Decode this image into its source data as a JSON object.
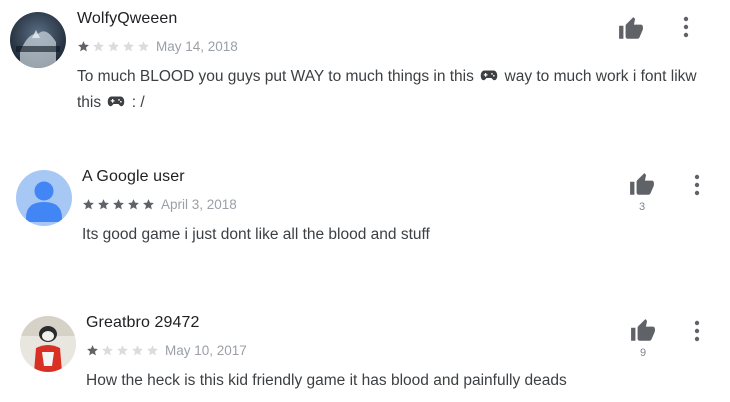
{
  "colors": {
    "star_filled": "#5f6368",
    "star_empty": "#dadce0",
    "icon": "#5f6368"
  },
  "reviews": [
    {
      "author": "WolfyQweeen",
      "rating": 1,
      "date": "May 14, 2018",
      "text_line1": "To much BLOOD you guys put WAY to much things in this",
      "text_line1b": "way to much work i font likw",
      "text_line2": "this",
      "text_line2b": ": /",
      "emoji_icon": "gamepad-icon",
      "helpful_count": ""
    },
    {
      "author": "A Google user",
      "rating": 5,
      "date": "April 3, 2018",
      "text": "Its good game i just dont like all the blood and stuff",
      "helpful_count": "3"
    },
    {
      "author": "Greatbro 29472",
      "rating": 1,
      "date": "May 10, 2017",
      "text": "How the heck is this kid friendly game it has blood and painfully deads",
      "helpful_count": "9"
    }
  ]
}
